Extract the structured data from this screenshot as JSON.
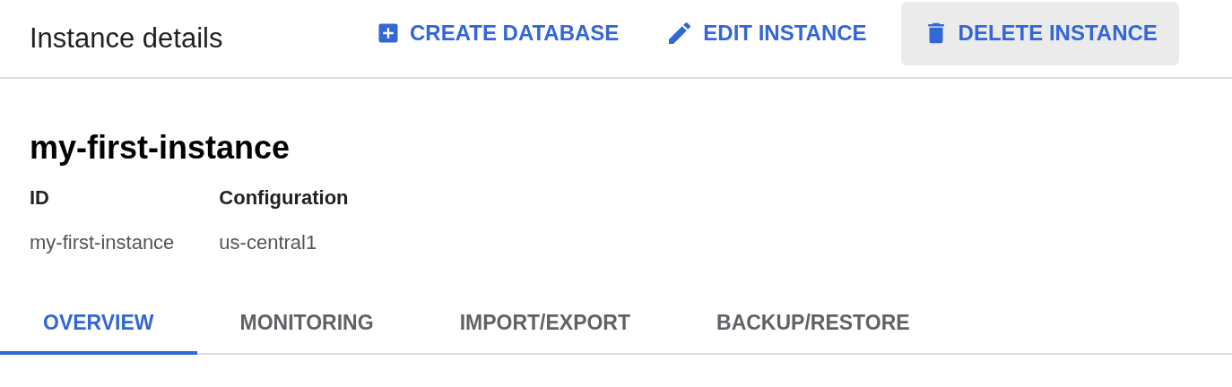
{
  "header": {
    "title": "Instance details",
    "actions": [
      {
        "kind": "create",
        "label": "CREATE DATABASE",
        "hovered": false
      },
      {
        "kind": "edit",
        "label": "EDIT INSTANCE",
        "hovered": false
      },
      {
        "kind": "delete",
        "label": "DELETE INSTANCE",
        "hovered": true
      }
    ]
  },
  "instance": {
    "name": "my-first-instance",
    "fields": [
      {
        "label": "ID",
        "value": "my-first-instance"
      },
      {
        "label": "Configuration",
        "value": "us-central1"
      }
    ]
  },
  "tabs": [
    {
      "label": "OVERVIEW",
      "selected": true
    },
    {
      "label": "MONITORING",
      "selected": false
    },
    {
      "label": "IMPORT/EXPORT",
      "selected": false
    },
    {
      "label": "BACKUP/RESTORE",
      "selected": false
    }
  ]
}
